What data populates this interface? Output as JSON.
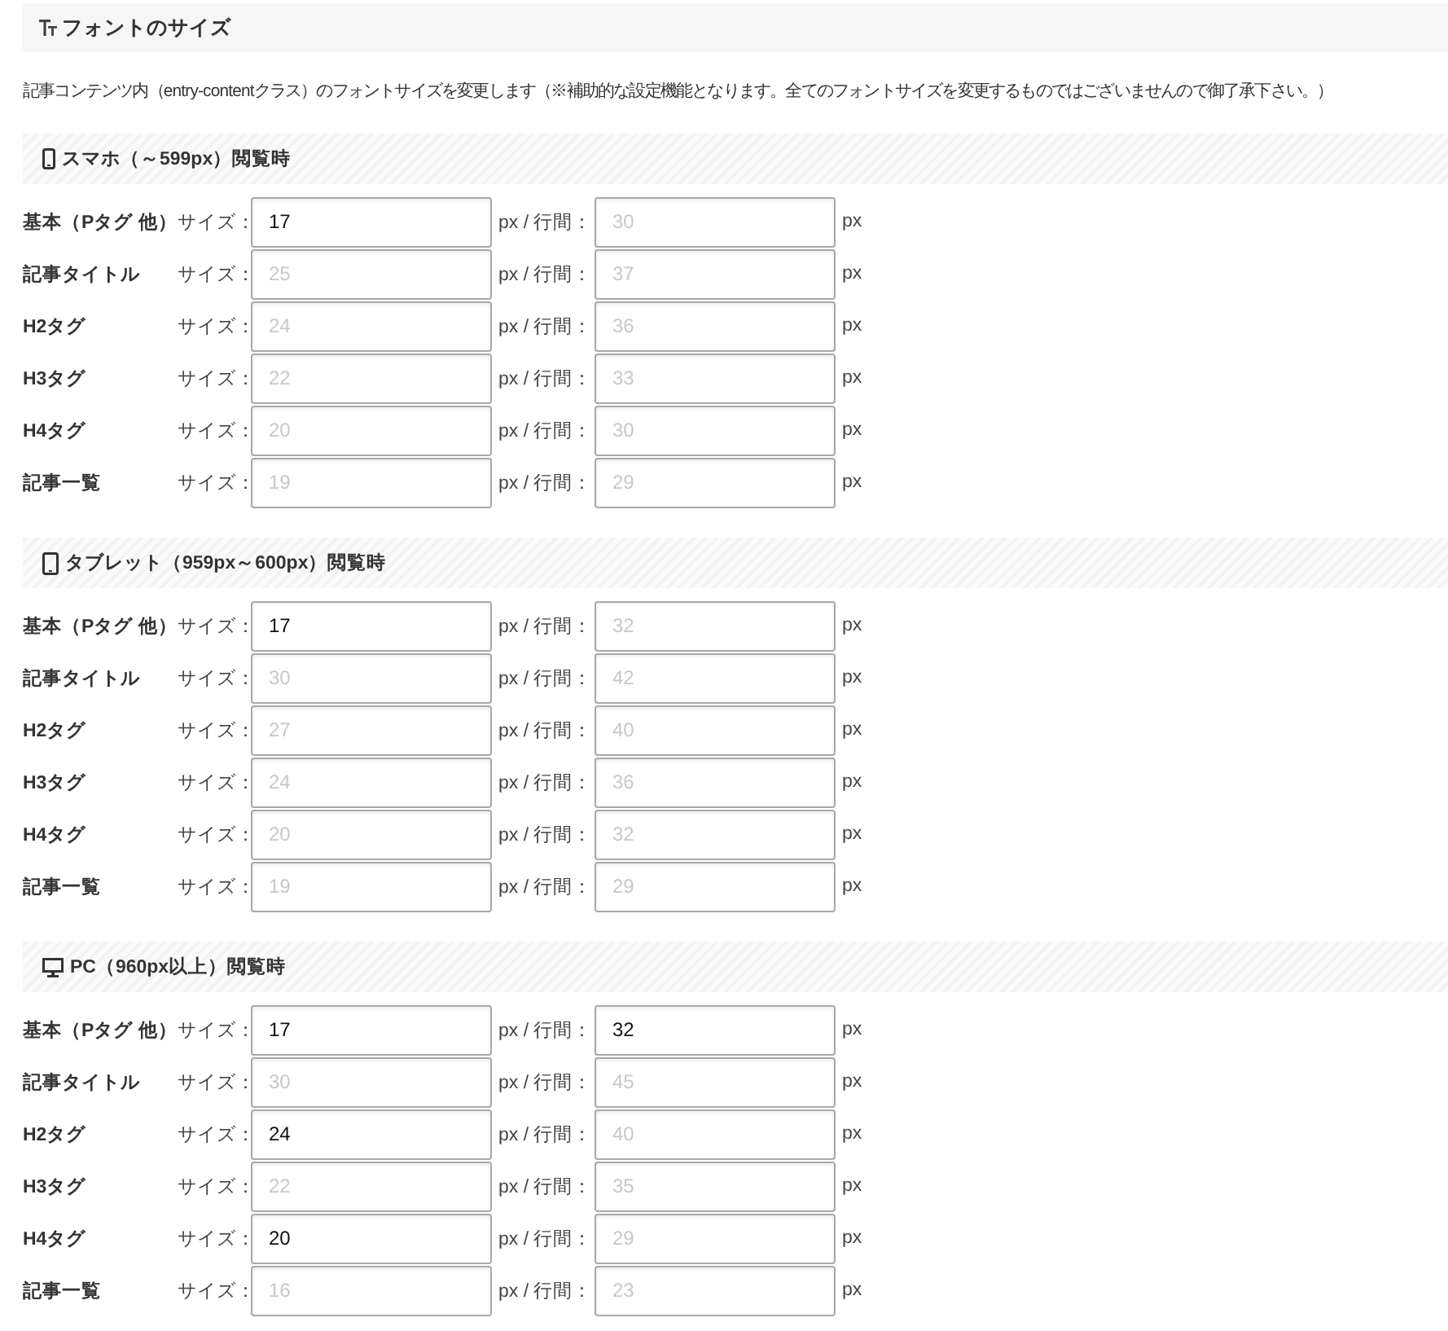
{
  "title": {
    "text": "フォントのサイズ"
  },
  "description": "記事コンテンツ内（entry-contentクラス）のフォントサイズを変更します（※補助的な設定機能となります。全てのフォントサイズを変更するものではございませんので御了承下さい。）",
  "sections": [
    {
      "kind": "phone",
      "heading": "スマホ（～599px）閲覧時",
      "rows": [
        {
          "label": "基本（Pタグ 他）",
          "size_label": "サイズ：",
          "size": {
            "value": "17"
          },
          "line_label": "px / 行間：",
          "line_height": {
            "placeholder": "30"
          },
          "unit": "px"
        },
        {
          "label": "記事タイトル",
          "size_label": "サイズ：",
          "size": {
            "placeholder": "25"
          },
          "line_label": "px / 行間：",
          "line_height": {
            "placeholder": "37"
          },
          "unit": "px"
        },
        {
          "label": "H2タグ",
          "size_label": "サイズ：",
          "size": {
            "placeholder": "24"
          },
          "line_label": "px / 行間：",
          "line_height": {
            "placeholder": "36"
          },
          "unit": "px"
        },
        {
          "label": "H3タグ",
          "size_label": "サイズ：",
          "size": {
            "placeholder": "22"
          },
          "line_label": "px / 行間：",
          "line_height": {
            "placeholder": "33"
          },
          "unit": "px"
        },
        {
          "label": "H4タグ",
          "size_label": "サイズ：",
          "size": {
            "placeholder": "20"
          },
          "line_label": "px / 行間：",
          "line_height": {
            "placeholder": "30"
          },
          "unit": "px"
        },
        {
          "label": "記事一覧",
          "size_label": "サイズ：",
          "size": {
            "placeholder": "19"
          },
          "line_label": "px / 行間：",
          "line_height": {
            "placeholder": "29"
          },
          "unit": "px"
        }
      ]
    },
    {
      "kind": "tablet",
      "heading": "タブレット（959px～600px）閲覧時",
      "rows": [
        {
          "label": "基本（Pタグ 他）",
          "size_label": "サイズ：",
          "size": {
            "value": "17"
          },
          "line_label": "px / 行間：",
          "line_height": {
            "placeholder": "32"
          },
          "unit": "px"
        },
        {
          "label": "記事タイトル",
          "size_label": "サイズ：",
          "size": {
            "placeholder": "30"
          },
          "line_label": "px / 行間：",
          "line_height": {
            "placeholder": "42"
          },
          "unit": "px"
        },
        {
          "label": "H2タグ",
          "size_label": "サイズ：",
          "size": {
            "placeholder": "27"
          },
          "line_label": "px / 行間：",
          "line_height": {
            "placeholder": "40"
          },
          "unit": "px"
        },
        {
          "label": "H3タグ",
          "size_label": "サイズ：",
          "size": {
            "placeholder": "24"
          },
          "line_label": "px / 行間：",
          "line_height": {
            "placeholder": "36"
          },
          "unit": "px"
        },
        {
          "label": "H4タグ",
          "size_label": "サイズ：",
          "size": {
            "placeholder": "20"
          },
          "line_label": "px / 行間：",
          "line_height": {
            "placeholder": "32"
          },
          "unit": "px"
        },
        {
          "label": "記事一覧",
          "size_label": "サイズ：",
          "size": {
            "placeholder": "19"
          },
          "line_label": "px / 行間：",
          "line_height": {
            "placeholder": "29"
          },
          "unit": "px"
        }
      ]
    },
    {
      "kind": "desktop",
      "heading": "PC（960px以上）閲覧時",
      "rows": [
        {
          "label": "基本（Pタグ 他）",
          "size_label": "サイズ：",
          "size": {
            "value": "17"
          },
          "line_label": "px / 行間：",
          "line_height": {
            "value": "32"
          },
          "unit": "px"
        },
        {
          "label": "記事タイトル",
          "size_label": "サイズ：",
          "size": {
            "placeholder": "30"
          },
          "line_label": "px / 行間：",
          "line_height": {
            "placeholder": "45"
          },
          "unit": "px"
        },
        {
          "label": "H2タグ",
          "size_label": "サイズ：",
          "size": {
            "value": "24"
          },
          "line_label": "px / 行間：",
          "line_height": {
            "placeholder": "40"
          },
          "unit": "px"
        },
        {
          "label": "H3タグ",
          "size_label": "サイズ：",
          "size": {
            "placeholder": "22"
          },
          "line_label": "px / 行間：",
          "line_height": {
            "placeholder": "35"
          },
          "unit": "px"
        },
        {
          "label": "H4タグ",
          "size_label": "サイズ：",
          "size": {
            "value": "20"
          },
          "line_label": "px / 行間：",
          "line_height": {
            "placeholder": "29"
          },
          "unit": "px"
        },
        {
          "label": "記事一覧",
          "size_label": "サイズ：",
          "size": {
            "placeholder": "16"
          },
          "line_label": "px / 行間：",
          "line_height": {
            "placeholder": "23"
          },
          "unit": "px"
        }
      ]
    }
  ]
}
